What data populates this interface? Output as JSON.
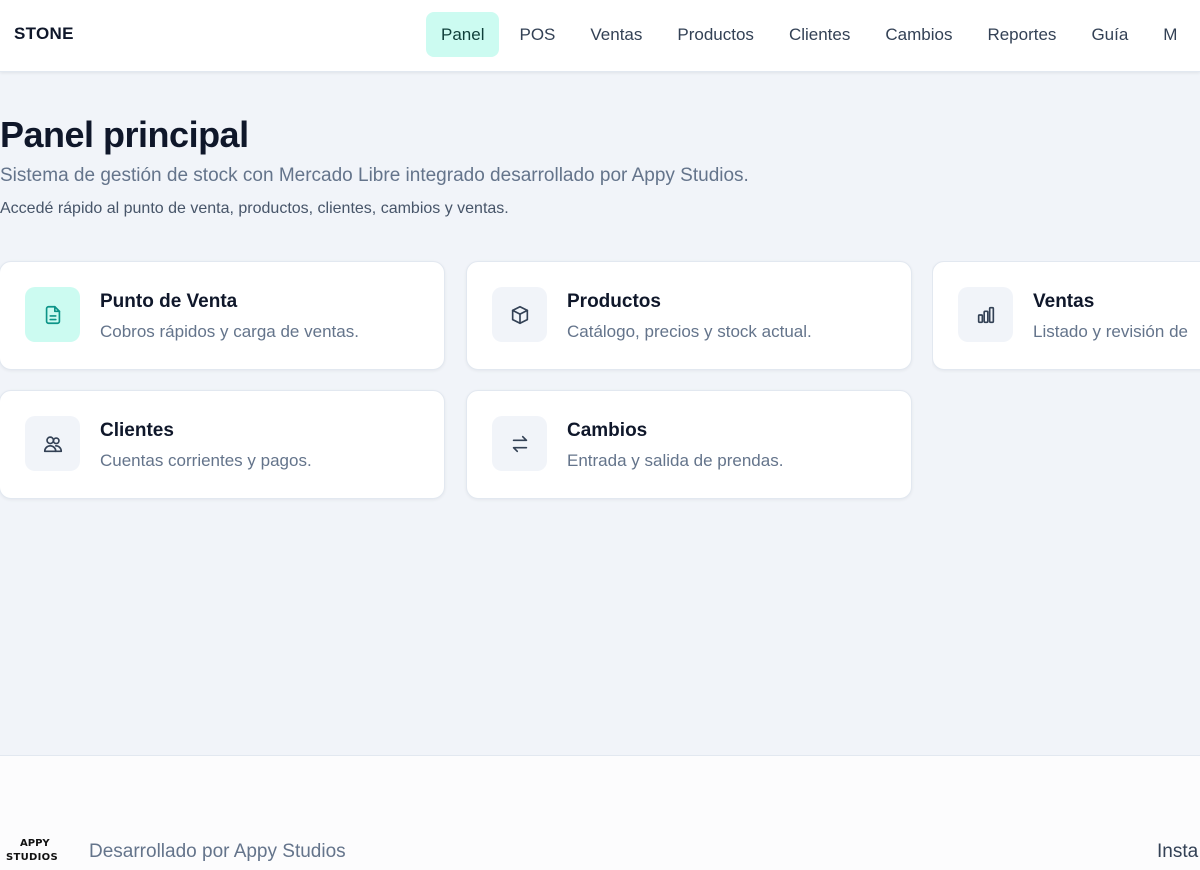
{
  "brand": "STONE",
  "nav": {
    "items": [
      {
        "label": "Panel",
        "active": true
      },
      {
        "label": "POS",
        "active": false
      },
      {
        "label": "Ventas",
        "active": false
      },
      {
        "label": "Productos",
        "active": false
      },
      {
        "label": "Clientes",
        "active": false
      },
      {
        "label": "Cambios",
        "active": false
      },
      {
        "label": "Reportes",
        "active": false
      },
      {
        "label": "Guía",
        "active": false
      },
      {
        "label": "M",
        "active": false
      }
    ]
  },
  "page": {
    "title": "Panel principal",
    "subtitle": "Sistema de gestión de stock con Mercado Libre integrado desarrollado por Appy Studios.",
    "description": "Accedé rápido al punto de venta, productos, clientes, cambios y ventas."
  },
  "cards": [
    {
      "title": "Punto de Venta",
      "description": "Cobros rápidos y carga de ventas.",
      "icon": "document-icon"
    },
    {
      "title": "Productos",
      "description": "Catálogo, precios y stock actual.",
      "icon": "box-icon"
    },
    {
      "title": "Ventas",
      "description": "Listado y revisión de",
      "icon": "bar-chart-icon"
    },
    {
      "title": "Clientes",
      "description": "Cuentas corrientes y pagos.",
      "icon": "users-icon"
    },
    {
      "title": "Cambios",
      "description": "Entrada y salida de prendas.",
      "icon": "swap-icon"
    }
  ],
  "footer": {
    "logo_top": "APPY",
    "logo_bottom": "STUDIOS",
    "text": "Desarrollado por Appy Studios",
    "right_text": "Insta"
  },
  "colors": {
    "accent": "#ccfbf1",
    "accent_icon": "#0d9488",
    "background": "#f1f4f9"
  }
}
